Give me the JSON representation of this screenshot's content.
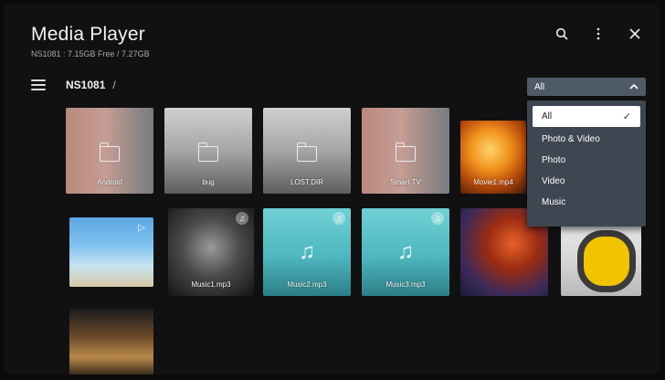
{
  "app": {
    "title": "Media Player",
    "storage": "NS1081 : 7.15GB Free / 7.27GB"
  },
  "topbar": {
    "search_icon": "search-icon",
    "more_icon": "more-vertical-icon",
    "close_icon": "close-icon"
  },
  "nav": {
    "menu_icon": "hamburger-icon",
    "breadcrumb": "NS1081",
    "separator": "/"
  },
  "filter": {
    "selected": "All",
    "options": [
      "All",
      "Photo & Video",
      "Photo",
      "Video",
      "Music"
    ]
  },
  "grid": {
    "row1": [
      "Android",
      "bug",
      "LOST.DIR",
      "Smart TV",
      "Movie1.mp4"
    ],
    "row2": [
      "",
      "Music1.mp3",
      "Music2.mp3",
      "Music3.mp3",
      "",
      ""
    ],
    "row3": [
      ""
    ]
  },
  "colors": {
    "dropdown": "#4f5a69",
    "menu": "#3e4652",
    "music_tile": "#5ec3c9"
  }
}
